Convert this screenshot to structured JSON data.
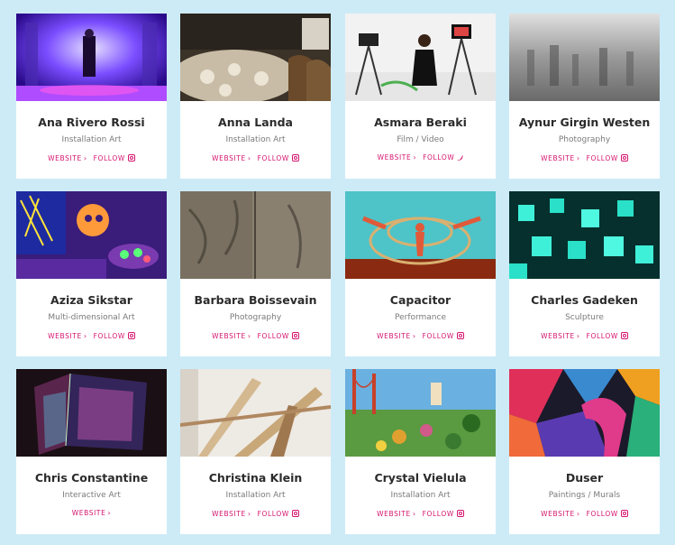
{
  "colors": {
    "background": "#cdebf7",
    "card": "#ffffff",
    "accent": "#d4146e"
  },
  "artists": [
    {
      "name": "Ana Rivero Rossi",
      "category": "Installation Art",
      "website": "WEBSITE",
      "follow": "FOLLOW",
      "follow_icon": "instagram-icon"
    },
    {
      "name": "Anna Landa",
      "category": "Installation Art",
      "website": "WEBSITE",
      "follow": "FOLLOW",
      "follow_icon": "instagram-icon"
    },
    {
      "name": "Asmara Beraki",
      "category": "Film / Video",
      "website": "WEBSITE",
      "follow": "FOLLOW",
      "follow_icon": "twitter-icon"
    },
    {
      "name": "Aynur Girgin Westen",
      "category": "Photography",
      "website": "WEBSITE",
      "follow": "FOLLOW",
      "follow_icon": "instagram-icon"
    },
    {
      "name": "Aziza Sikstar",
      "category": "Multi-dimensional Art",
      "website": "WEBSITE",
      "follow": "FOLLOW",
      "follow_icon": "instagram-icon"
    },
    {
      "name": "Barbara Boissevain",
      "category": "Photography",
      "website": "WEBSITE",
      "follow": "FOLLOW",
      "follow_icon": "instagram-icon"
    },
    {
      "name": "Capacitor",
      "category": "Performance",
      "website": "WEBSITE",
      "follow": "FOLLOW",
      "follow_icon": "instagram-icon"
    },
    {
      "name": "Charles Gadeken",
      "category": "Sculpture",
      "website": "WEBSITE",
      "follow": "FOLLOW",
      "follow_icon": "instagram-icon"
    },
    {
      "name": "Chris Constantine",
      "category": "Interactive Art",
      "website": "WEBSITE",
      "follow": "",
      "follow_icon": ""
    },
    {
      "name": "Christina Klein",
      "category": "Installation Art",
      "website": "WEBSITE",
      "follow": "FOLLOW",
      "follow_icon": "instagram-icon"
    },
    {
      "name": "Crystal Vielula",
      "category": "Installation Art",
      "website": "WEBSITE",
      "follow": "FOLLOW",
      "follow_icon": "instagram-icon"
    },
    {
      "name": "Duser",
      "category": "Paintings / Murals",
      "website": "WEBSITE",
      "follow": "FOLLOW",
      "follow_icon": "instagram-icon"
    }
  ]
}
